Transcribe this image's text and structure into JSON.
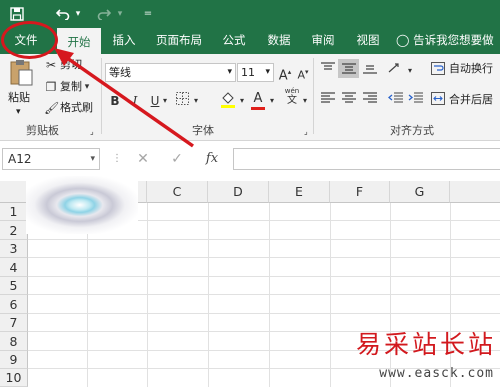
{
  "titlebar": {
    "save_icon": "save-icon",
    "undo_icon": "undo-icon",
    "redo_icon": "redo-icon",
    "customize_icon": "customize-qat-icon"
  },
  "tabs": [
    {
      "label": "文件"
    },
    {
      "label": "开始"
    },
    {
      "label": "插入"
    },
    {
      "label": "页面布局"
    },
    {
      "label": "公式"
    },
    {
      "label": "数据"
    },
    {
      "label": "审阅"
    },
    {
      "label": "视图"
    }
  ],
  "tell_me": "告诉我您想要做",
  "clipboard": {
    "paste": "粘贴",
    "cut": "剪切",
    "copy": "复制",
    "format_painter": "格式刷",
    "group": "剪贴板"
  },
  "font": {
    "name": "等线",
    "size": "11",
    "grow": "A",
    "shrink": "A",
    "bold": "B",
    "italic": "I",
    "underline": "U",
    "font_color": "A",
    "phonetic": "wén",
    "group": "字体"
  },
  "alignment": {
    "wrap": "自动换行",
    "merge": "合并后居",
    "group": "对齐方式"
  },
  "formula_bar": {
    "name_box": "A12",
    "cancel": "✕",
    "enter": "✓",
    "fx": "fx",
    "value": ""
  },
  "columns": [
    "C",
    "D",
    "E",
    "F",
    "G"
  ],
  "rows": [
    "1",
    "2",
    "3",
    "4",
    "5",
    "6",
    "7",
    "8",
    "9",
    "10"
  ],
  "watermark": {
    "site": "易采站长站",
    "url": "www.easck.com"
  },
  "colors": {
    "excel_green": "#217346",
    "annotation_red": "#d6181e"
  }
}
